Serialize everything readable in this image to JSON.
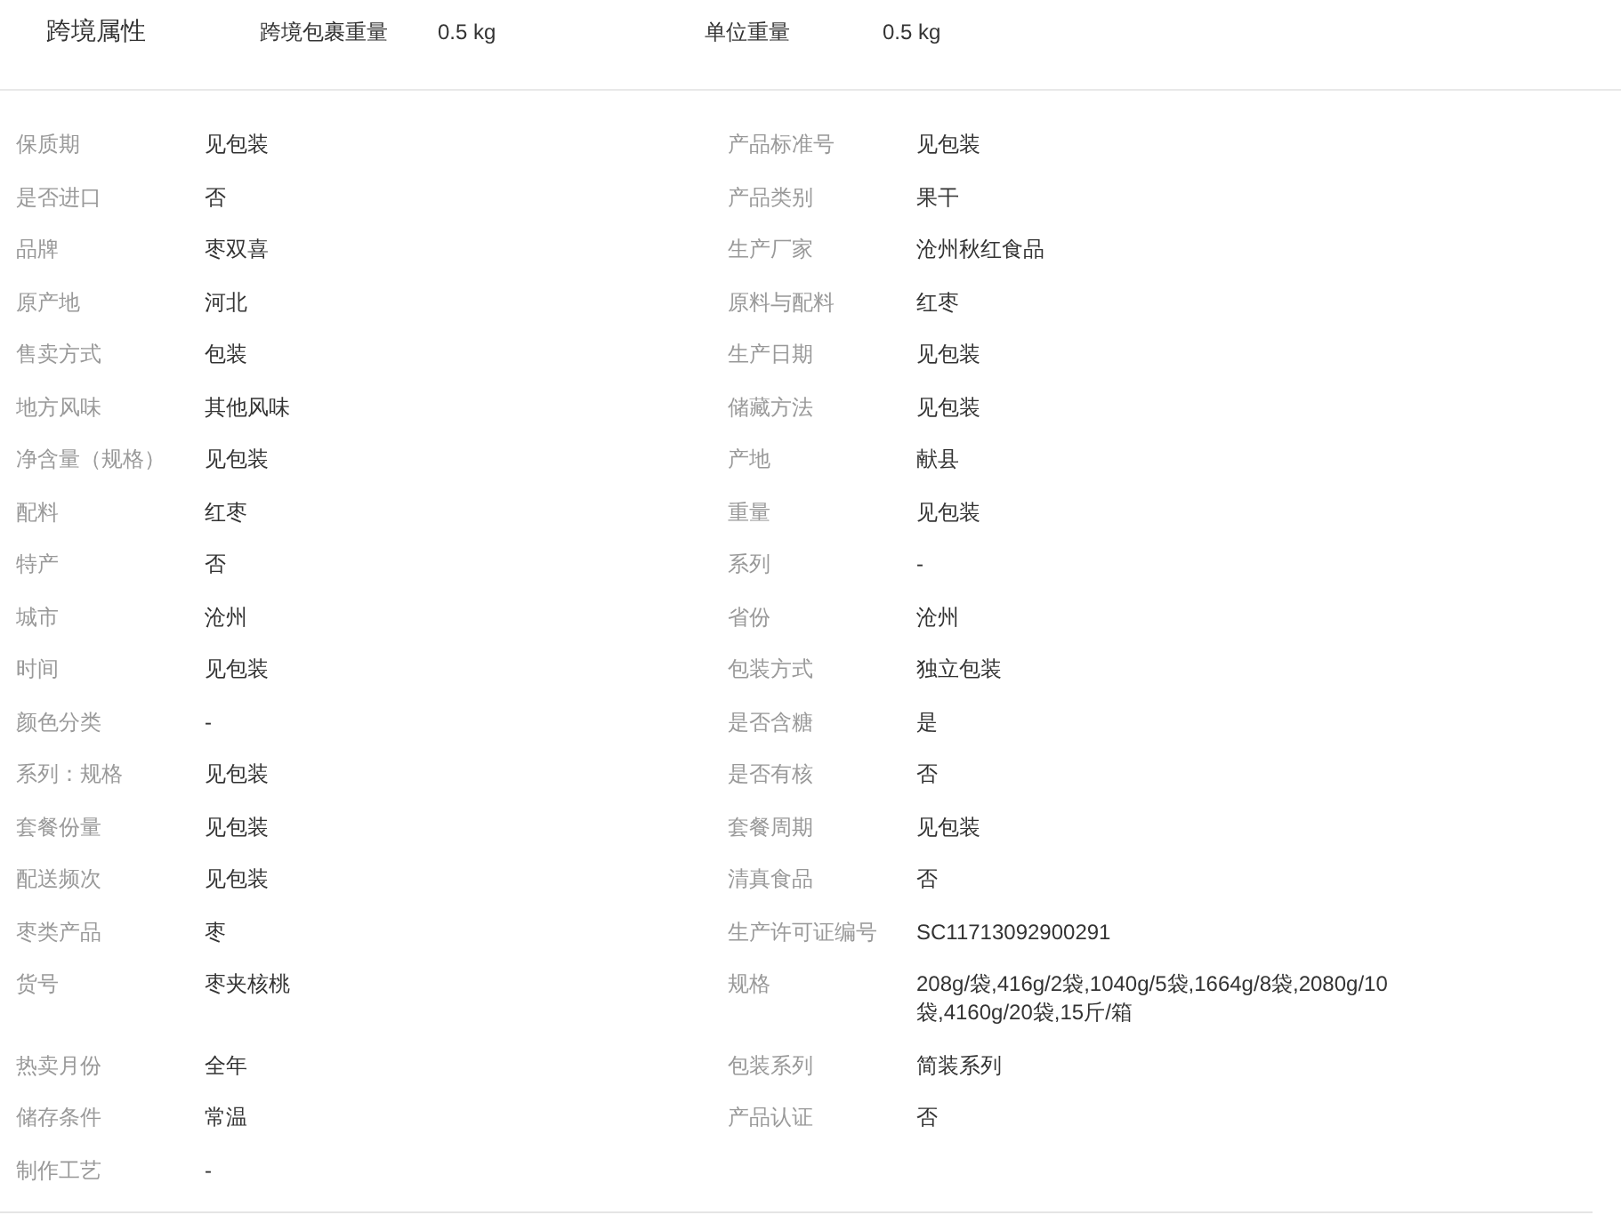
{
  "cross_border": {
    "title": "跨境属性",
    "fields": [
      {
        "label": "跨境包裹重量",
        "value": "0.5 kg"
      },
      {
        "label": "单位重量",
        "value": "0.5 kg"
      }
    ]
  },
  "attributes": [
    {
      "label": "保质期",
      "value": "见包装"
    },
    {
      "label": "产品标准号",
      "value": "见包装"
    },
    {
      "label": "是否进口",
      "value": "否"
    },
    {
      "label": "产品类别",
      "value": "果干"
    },
    {
      "label": "品牌",
      "value": "枣双喜"
    },
    {
      "label": "生产厂家",
      "value": "沧州秋红食品"
    },
    {
      "label": "原产地",
      "value": "河北"
    },
    {
      "label": "原料与配料",
      "value": "红枣"
    },
    {
      "label": "售卖方式",
      "value": "包装"
    },
    {
      "label": "生产日期",
      "value": "见包装"
    },
    {
      "label": "地方风味",
      "value": "其他风味"
    },
    {
      "label": "储藏方法",
      "value": "见包装"
    },
    {
      "label": "净含量（规格）",
      "value": "见包装"
    },
    {
      "label": "产地",
      "value": "献县"
    },
    {
      "label": "配料",
      "value": "红枣"
    },
    {
      "label": "重量",
      "value": "见包装"
    },
    {
      "label": "特产",
      "value": "否"
    },
    {
      "label": "系列",
      "value": "-"
    },
    {
      "label": "城市",
      "value": "沧州"
    },
    {
      "label": "省份",
      "value": "沧州"
    },
    {
      "label": "时间",
      "value": "见包装"
    },
    {
      "label": "包装方式",
      "value": "独立包装"
    },
    {
      "label": "颜色分类",
      "value": "-"
    },
    {
      "label": "是否含糖",
      "value": "是"
    },
    {
      "label": "系列：规格",
      "value": "见包装"
    },
    {
      "label": "是否有核",
      "value": "否"
    },
    {
      "label": "套餐份量",
      "value": "见包装"
    },
    {
      "label": "套餐周期",
      "value": "见包装"
    },
    {
      "label": "配送频次",
      "value": "见包装"
    },
    {
      "label": "清真食品",
      "value": "否"
    },
    {
      "label": "枣类产品",
      "value": "枣"
    },
    {
      "label": "生产许可证编号",
      "value": "SC11713092900291"
    },
    {
      "label": "货号",
      "value": "枣夹核桃"
    },
    {
      "label": "规格",
      "value": "208g/袋,416g/2袋,1040g/5袋,1664g/8袋,2080g/10袋,4160g/20袋,15斤/箱"
    },
    {
      "label": "热卖月份",
      "value": "全年"
    },
    {
      "label": "包装系列",
      "value": "简装系列"
    },
    {
      "label": "储存条件",
      "value": "常温"
    },
    {
      "label": "产品认证",
      "value": "否"
    },
    {
      "label": "制作工艺",
      "value": "-"
    }
  ]
}
